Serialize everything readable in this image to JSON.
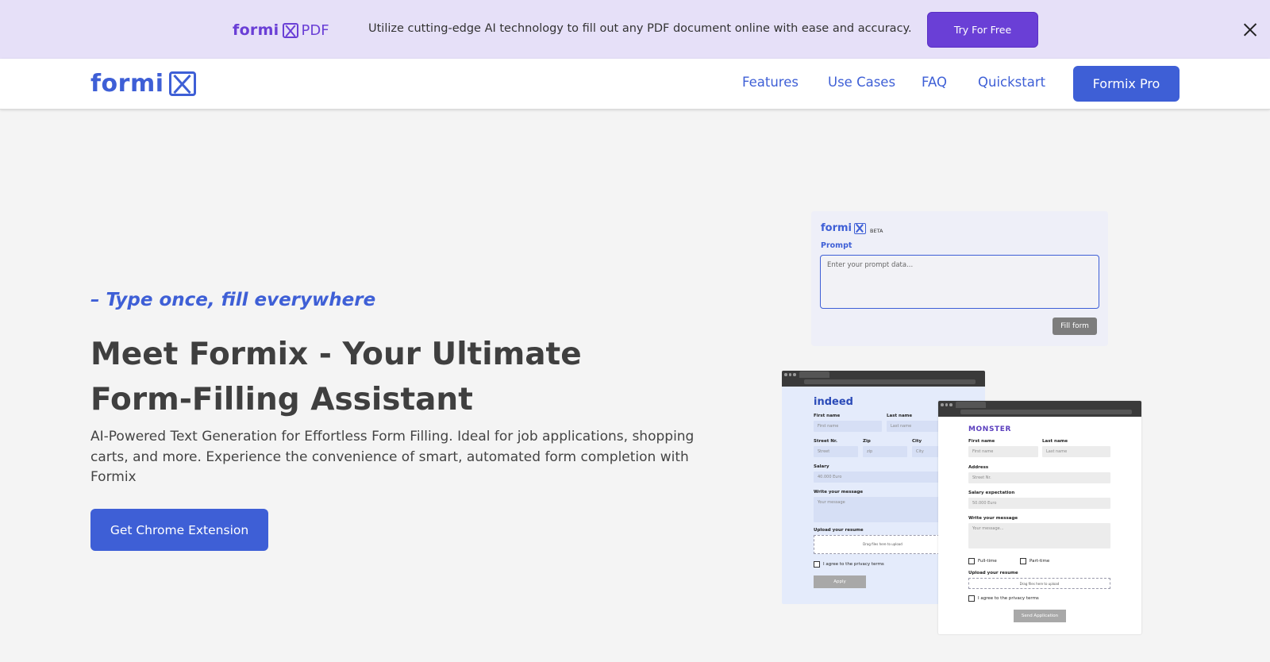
{
  "promo": {
    "logo_word": "formi",
    "logo_suffix": "PDF",
    "text": "Utilize cutting-edge AI technology to fill out any PDF document online with ease and accuracy.",
    "cta": "Try For Free",
    "accent": "#6a3fd6",
    "background": "#e6e0f8"
  },
  "nav": {
    "logo_word": "formi",
    "links": [
      "Features",
      "Use Cases",
      "FAQ",
      "Quickstart"
    ],
    "cta": "Formix Pro",
    "accent": "#3e5fd6"
  },
  "hero": {
    "tagline": "– Type once, fill everywhere",
    "title_line1": "Meet Formix - Your Ultimate",
    "title_line2": "Form-Filling Assistant",
    "description": "AI-Powered Text Generation for Effortless Form Filling. Ideal for job applications, shopping carts, and more. Experience the convenience of smart, automated form completion with Formix",
    "cta": "Get Chrome Extension"
  },
  "illustration": {
    "panel": {
      "logo_word": "formi",
      "beta": "BETA",
      "label": "Prompt",
      "placeholder": "Enter your prompt data...",
      "button": "Fill form"
    },
    "indeed": {
      "brand": "indeed",
      "first_name_label": "First name",
      "first_name_placeholder": "First name",
      "last_name_label": "Last name",
      "last_name_placeholder": "Last name",
      "street_label": "Street Nr.",
      "street_placeholder": "Street",
      "zip_label": "Zip",
      "zip_placeholder": "zip",
      "city_label": "City",
      "city_placeholder": "City",
      "salary_label": "Salary",
      "salary_value": "40.000 Euro",
      "message_label": "Write your message",
      "message_placeholder": "Your message",
      "upload_label": "Upload your resume",
      "upload_text": "Drag files here to upload",
      "privacy": "I agree to the privacy terms",
      "button": "Apply"
    },
    "monster": {
      "brand": "MONSTER",
      "first_name_label": "First name",
      "first_name_placeholder": "First name",
      "last_name_label": "Last name",
      "last_name_placeholder": "Last name",
      "address_label": "Address",
      "address_placeholder": "Street Nr.",
      "salary_label": "Salary expectation",
      "salary_value": "50.000 Euro",
      "message_label": "Write your message",
      "message_placeholder": "Your message...",
      "full_time": "Full-time",
      "part_time": "Part-time",
      "upload_label": "Upload your resume",
      "upload_text": "Drag files here to upload",
      "privacy": "I agree to the privacy terms",
      "button": "Send Application"
    }
  }
}
